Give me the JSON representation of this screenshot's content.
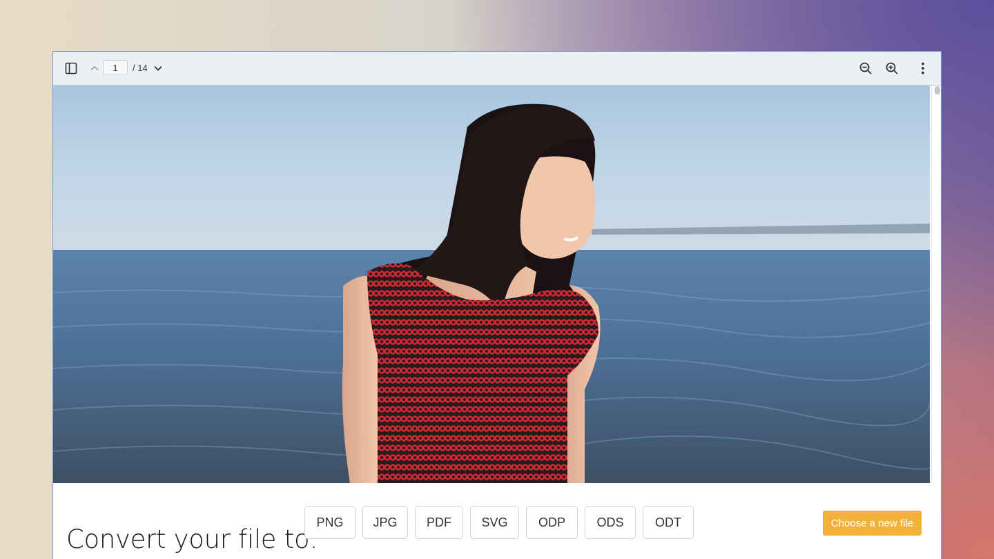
{
  "toolbar": {
    "icons": {
      "sidebar": "sidebar-toggle-icon",
      "prev": "chevron-up-icon",
      "next": "chevron-down-icon",
      "zoom_out": "zoom-out-icon",
      "zoom_in": "zoom-in-icon",
      "more": "more-vertical-icon"
    },
    "page_current": "1",
    "page_total": "/ 14"
  },
  "document": {
    "image": "photo of a smiling woman with dark hair wearing a red crochet top standing in front of the sea under a clear blue sky"
  },
  "convert": {
    "title": "Convert your file to:",
    "formats": [
      "PNG",
      "JPG",
      "PDF",
      "SVG",
      "ODP",
      "ODS",
      "ODT"
    ],
    "choose_label": "Choose a new file"
  },
  "colors": {
    "accent": "#f2b23c",
    "window_border": "#6fa0d8",
    "toolbar_bg": "#ecf0f4"
  }
}
